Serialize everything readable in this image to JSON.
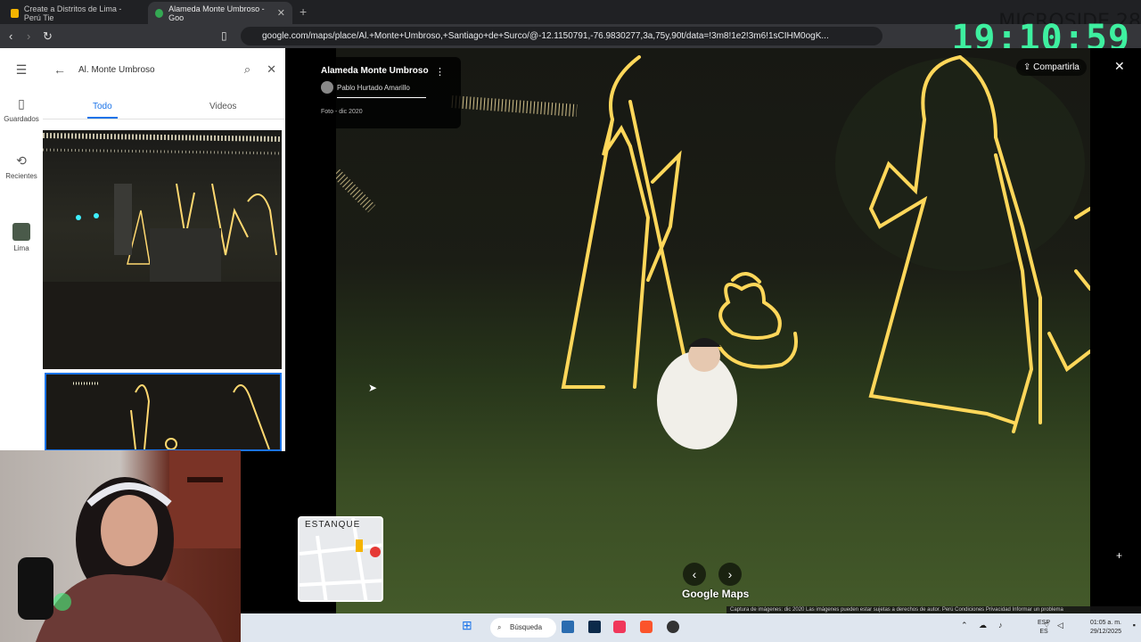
{
  "browser": {
    "tabs": [
      {
        "title": "Create a Distritos de Lima - Perú Tie"
      },
      {
        "title": "Alameda Monte Umbroso - Goo"
      }
    ],
    "url": "google.com/maps/place/Al.+Monte+Umbroso,+Santiago+de+Surco/@-12.1150791,-76.9830277,3a,75y,90t/data=!3m8!1e2!3m6!1sCIHM0ogK..."
  },
  "overlay": {
    "clock": "19:10:59",
    "watermark": "MICROSIDE 28"
  },
  "rail": {
    "items": [
      {
        "label": "Guardados"
      },
      {
        "label": "Recientes"
      },
      {
        "label": "Lima"
      }
    ]
  },
  "panel": {
    "search_value": "Al. Monte Umbroso",
    "tabs": [
      {
        "label": "Todo"
      },
      {
        "label": "Videos"
      }
    ]
  },
  "photo": {
    "title": "Alameda Monte Umbroso",
    "author": "Pablo Hurtado Amarillo",
    "date": "Foto - dic 2020",
    "share": "Compartirla",
    "minimap_label": "ESTANQUE",
    "logo": "Google Maps",
    "attribution": "Captura de imágenes: dic 2020   Las imágenes pueden estar sujetas a derechos de autor.   Perú   Condiciones   Privacidad   Informar un problema"
  },
  "taskbar": {
    "search": "Búsqueda",
    "lang_top": "ESP",
    "lang_bottom": "ES",
    "time": "01:05 a. m.",
    "date": "29/12/2025"
  },
  "colors": {
    "accent": "#1a73e8",
    "clock": "#3ef0a0"
  }
}
